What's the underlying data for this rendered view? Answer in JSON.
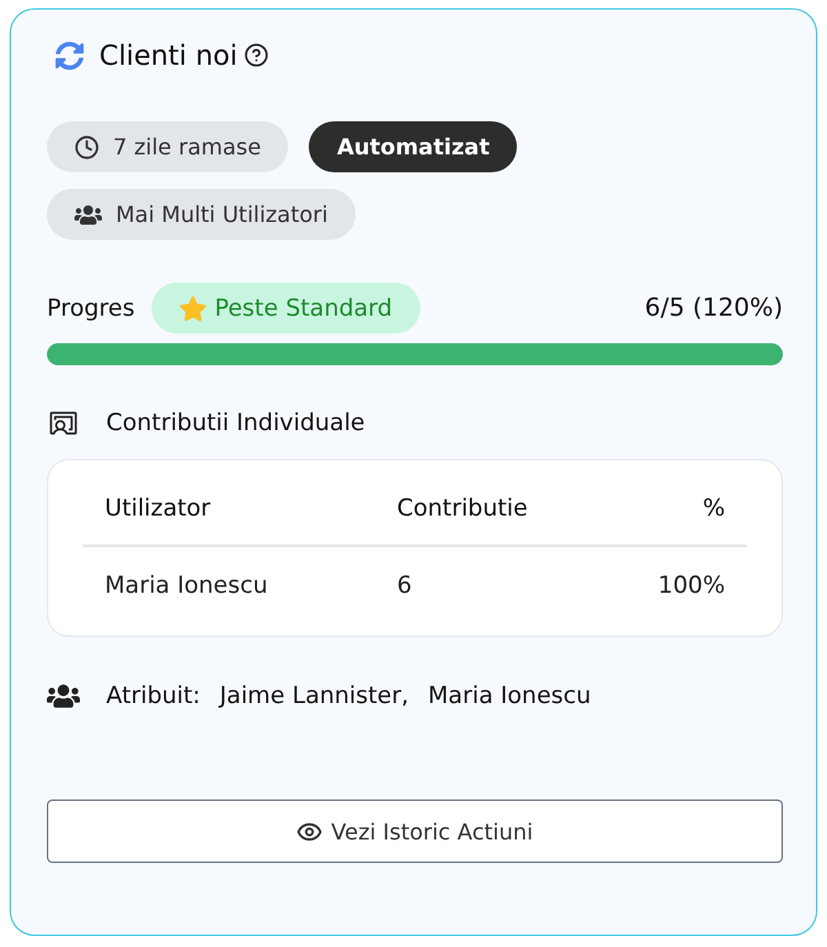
{
  "card": {
    "title": "Clienti noi"
  },
  "badges": [
    {
      "kind": "time",
      "label": "7 zile ramase"
    },
    {
      "kind": "mode",
      "label": "Automatizat"
    },
    {
      "kind": "users",
      "label": "Mai Multi Utilizatori"
    }
  ],
  "progress": {
    "label": "Progres",
    "status": "Peste Standard",
    "reading": "6/5 (120%)",
    "level": 1
  },
  "contributions": {
    "title": "Contributii Individuale",
    "columns": [
      "Utilizator",
      "Contributie",
      "%"
    ],
    "rows": [
      [
        "Maria Ionescu",
        "6",
        "100%"
      ]
    ]
  },
  "assigned": {
    "label": "Atribuit:",
    "users": [
      "Jaime Lannister,",
      "Maria Ionescu"
    ]
  },
  "history_button": {
    "label": "Vezi Istoric Actiuni"
  }
}
